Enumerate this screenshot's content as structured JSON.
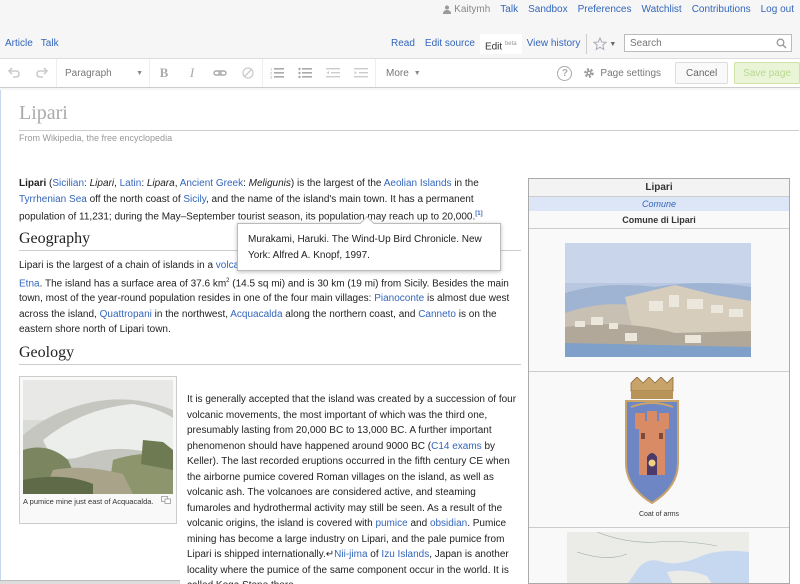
{
  "personal": {
    "username": "Kaitymh",
    "links": [
      "Talk",
      "Sandbox",
      "Preferences",
      "Watchlist",
      "Contributions",
      "Log out"
    ]
  },
  "tabs": {
    "left": [
      "Article",
      "Talk"
    ],
    "read": "Read",
    "edit_source": "Edit source",
    "edit": "Edit",
    "edit_badge": "beta",
    "view_history": "View history"
  },
  "search": {
    "placeholder": "Search"
  },
  "toolbar": {
    "format": "Paragraph",
    "more": "More",
    "page_settings": "Page settings",
    "cancel": "Cancel",
    "save": "Save page"
  },
  "article": {
    "title": "Lipari",
    "tagline": "From Wikipedia, the free encyclopedia",
    "intro": {
      "p1": "Lipari",
      "p2": " (",
      "p3": "Sicilian",
      "p4": ": ",
      "p5": "Lipari",
      "p6": ", ",
      "p7": "Latin",
      "p8": ": ",
      "p9": "Lipara",
      "p10": ", ",
      "p11": "Ancient Greek",
      "p12": ": ",
      "p13": "Meligunis",
      "p14": ") is the largest of the ",
      "p15": "Aeolian Islands",
      "p16": " in the ",
      "p17": "Tyrrhenian Sea",
      "p18": " off the north coast of ",
      "p19": "Sicily",
      "p20": ", and the name of the island's main town. It has a permanent population of 11,231; during the May–September tourist season, its population may reach up to 20,000.",
      "ref": "[1]"
    },
    "geography_heading": "Geography",
    "geography": {
      "p1": "Lipari is the largest of a chain of islands in a ",
      "p2": "volcanic",
      "p3": " arc",
      "p4": "Etna",
      "p5": ".  The island has a surface area of 37.6 km",
      "p5sup": "2",
      "p6": " (14.5 sq mi) and is 30 km (19 mi) from Sicily.  Besides the main town, most of the year-round population resides in one of the four main villages: ",
      "p7": "Pianoconte",
      "p8": " is almost due west across the island, ",
      "p9": "Quattropani",
      "p10": " in the northwest, ",
      "p11": "Acquacalda",
      "p12": " along the northern coast, and ",
      "p13": "Canneto",
      "p14": " is on the eastern shore north of Lipari town."
    },
    "geology_heading": "Geology",
    "geology": {
      "p1": "It is generally accepted that the island was created by a succession of four volcanic movements, the most important of which was the third one, presumably lasting from 20,000 BC to 13,000 BC. A further important phenomenon should have happened around 9000 BC (",
      "p2": "C14 exams",
      "p3": " by Keller). The last recorded eruptions occurred in the fifth century CE when the airborne pumice covered Roman villages on the island, as well as volcanic ash. The volcanoes are considered active, and steaming fumaroles and hydrothermal activity may still be seen. As a result of the volcanic origins, the island is covered with ",
      "p4": "pumice",
      "p5": " and ",
      "p6": "obsidian",
      "p7": ". Pumice mining has become a large industry on Lipari, and the pale pumice from Lipari is shipped internationally.↵",
      "p8": "Nii-jima",
      "p9": " of ",
      "p10": "Izu Islands",
      "p11": ", Japan is another locality where the pumice of the same component occur in the world. It is called Koga Stone there."
    },
    "thumb_caption": "A pumice mine just east of Acquacalda."
  },
  "tooltip": {
    "text": "Murakami, Haruki. The Wind-Up Bird Chronicle. New York: Alfred A. Knopf, 1997."
  },
  "infobox": {
    "title": "Lipari",
    "type": "Comune",
    "subtitle": "Comune di Lipari",
    "coat_label": "Coat of arms"
  },
  "colors": {
    "link": "#3366bb",
    "comune_band": "#dde6f7",
    "save_bg": "#eaf5d8"
  }
}
